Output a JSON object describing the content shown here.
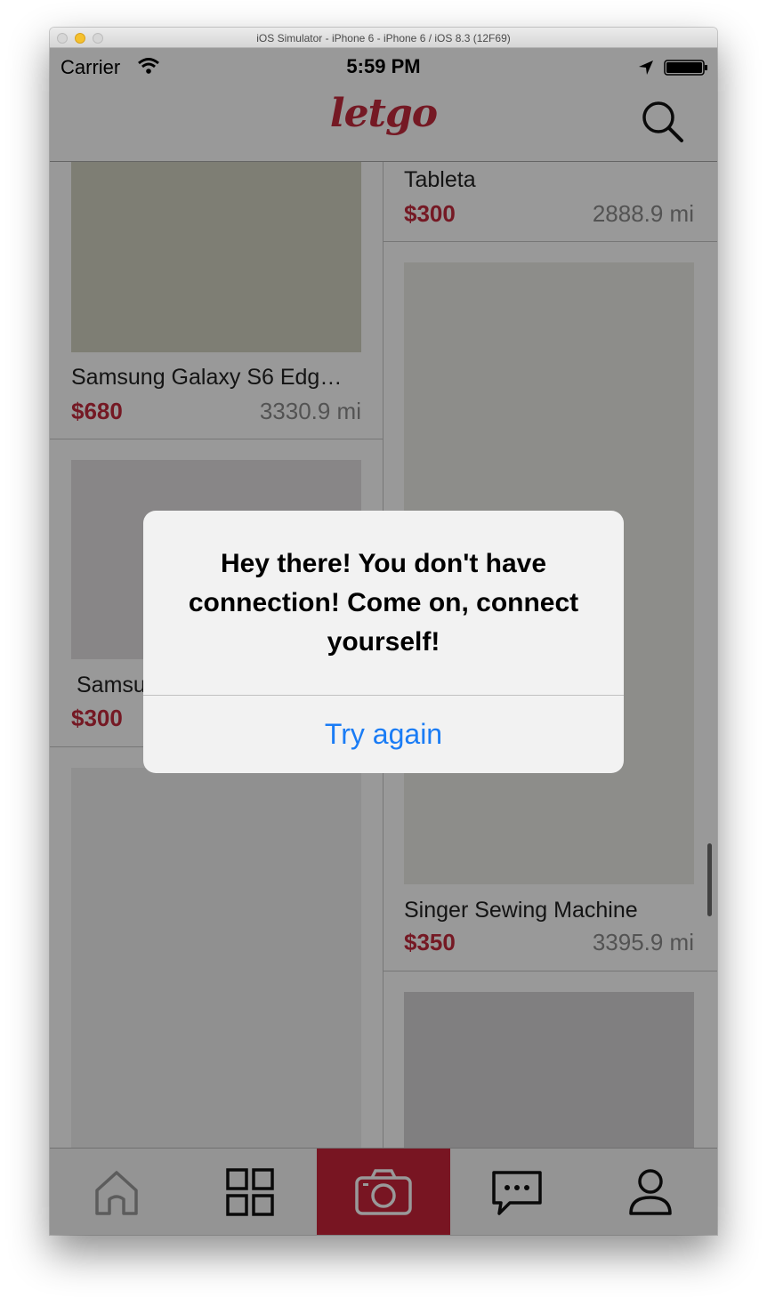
{
  "window": {
    "title": "iOS Simulator - iPhone 6 - iPhone 6 / iOS 8.3 (12F69)"
  },
  "status_bar": {
    "carrier": "Carrier",
    "time": "5:59 PM"
  },
  "navbar": {
    "logo": "letgo"
  },
  "products": [
    {
      "title": "Samsung Galaxy S6 Edg…",
      "price": "$680",
      "distance": "3330.9 mi",
      "image_color": "#d3d3c2"
    },
    {
      "title": "Tableta",
      "price": "$300",
      "distance": "2888.9 mi"
    },
    {
      "title": "Samsu",
      "price": "$300",
      "image_color": "#e3e0e1"
    },
    {
      "title": "Singer Sewing Machine",
      "price": "$350",
      "distance": "3395.9 mi",
      "image_color": "#ecebe7"
    }
  ],
  "tabbar": {
    "tabs": [
      {
        "name": "home",
        "icon": "home-icon"
      },
      {
        "name": "categories",
        "icon": "grid-icon"
      },
      {
        "name": "sell",
        "icon": "camera-icon",
        "active": true
      },
      {
        "name": "messages",
        "icon": "chat-icon"
      },
      {
        "name": "profile",
        "icon": "user-icon"
      }
    ]
  },
  "alert": {
    "message": "Hey there! You don't have connection! Come on, connect yourself!",
    "button_label": "Try again"
  },
  "colors": {
    "brand": "#c32a3c",
    "alert_button": "#1a7cf5"
  }
}
